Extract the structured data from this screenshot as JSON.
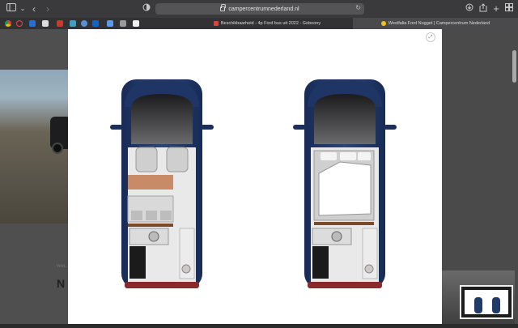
{
  "browser": {
    "url": "campercentrumnederland.nl",
    "tabs": [
      {
        "title": "Beschikbaarheid - 4p Ford bus uit 2022 - Goboony",
        "active": false
      },
      {
        "title": "Westfalia Ford Nugget | Campercentrum Nederland",
        "active": true
      }
    ]
  },
  "page": {
    "small_text": "Vind...",
    "heading": "N"
  },
  "colors": {
    "van_body": "#1f3565",
    "floor": "#e9e9e9",
    "table": "#c98b67",
    "seat": "#d8d8d8"
  }
}
